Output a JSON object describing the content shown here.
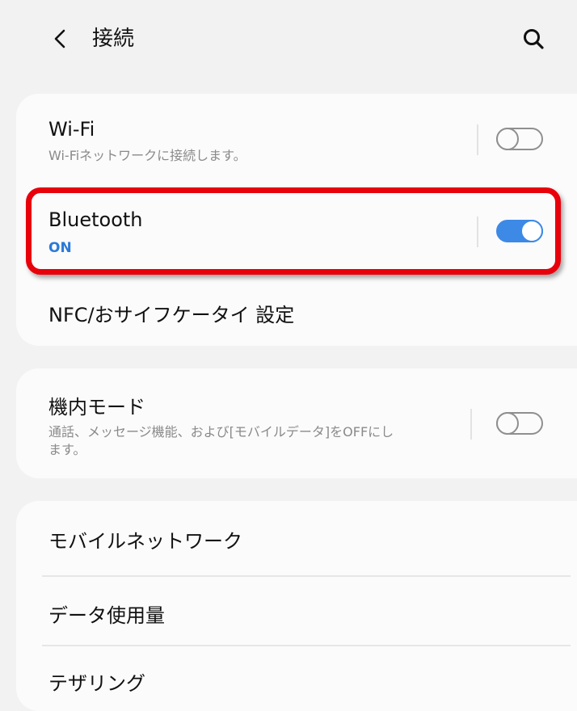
{
  "header": {
    "title": "接続",
    "back_icon": "chevron-left-icon",
    "search_icon": "search-icon"
  },
  "sections": {
    "wifi": {
      "title": "Wi-Fi",
      "subtitle": "Wi-Fiネットワークに接続します。",
      "toggle_on": false
    },
    "bluetooth": {
      "title": "Bluetooth",
      "subtitle": "ON",
      "toggle_on": true
    },
    "nfc": {
      "title": "NFC/おサイフケータイ 設定"
    },
    "airplane": {
      "title": "機内モード",
      "subtitle_line1": "通話、メッセージ機能、および[モバイルデータ]をOFFにし",
      "subtitle_line2": "ます。",
      "toggle_on": false
    },
    "mobile_network": {
      "title": "モバイルネットワーク"
    },
    "data_usage": {
      "title": "データ使用量"
    },
    "tethering": {
      "title": "テザリング"
    }
  },
  "colors": {
    "background": "#f2f2f2",
    "card": "#fbfbfb",
    "accent_blue": "#3d89e6",
    "highlight_red": "#e8000b",
    "subtext_gray": "#8a8a8a"
  }
}
